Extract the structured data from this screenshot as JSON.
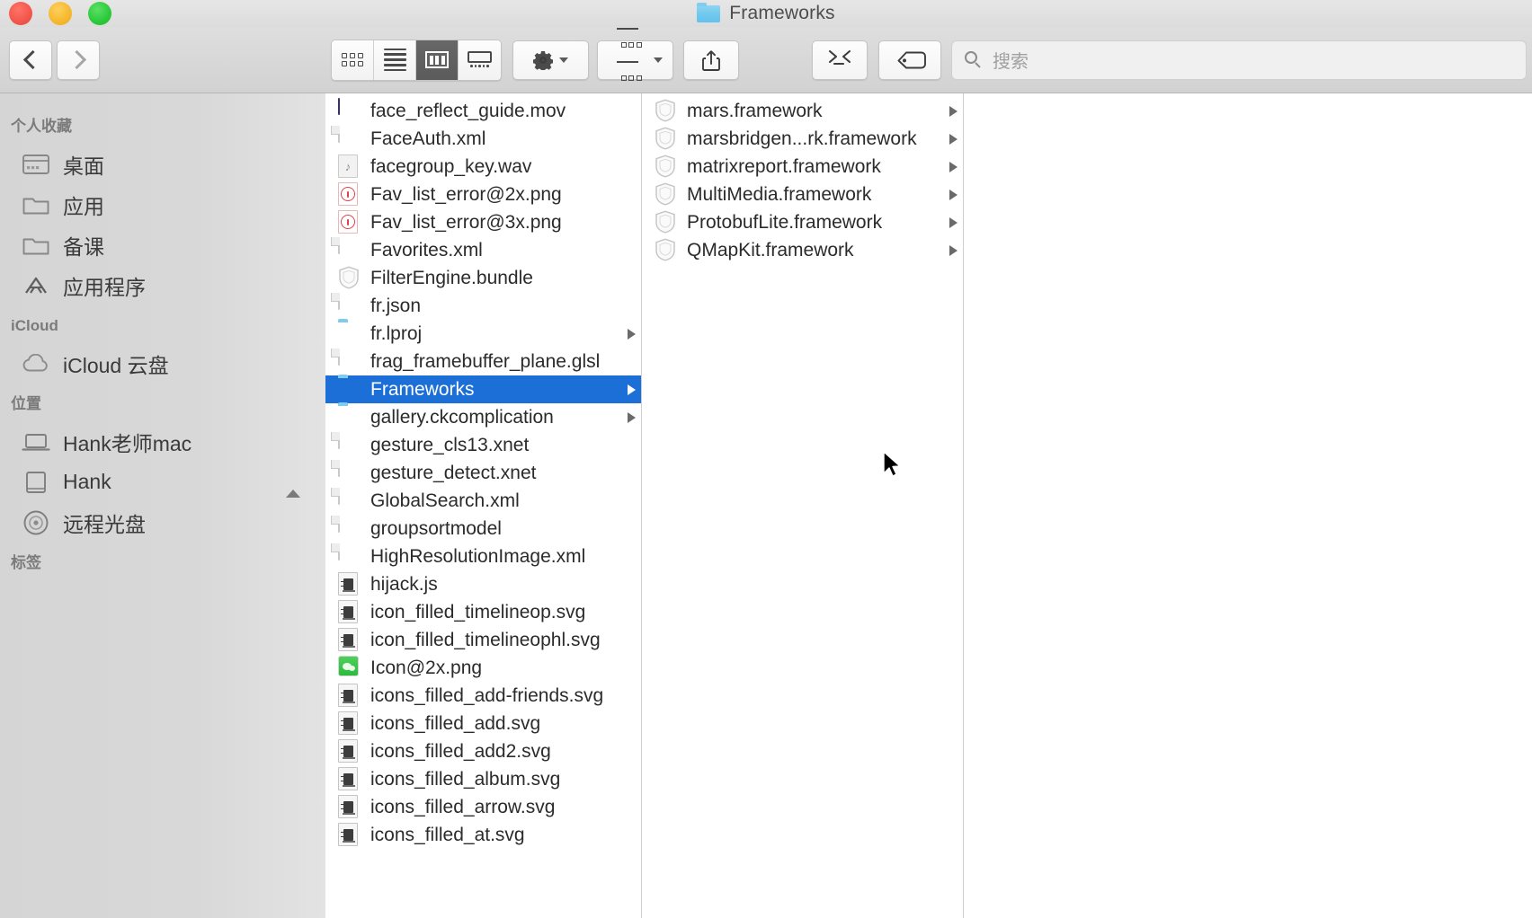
{
  "window": {
    "title": "Frameworks",
    "title_icon": "folder-icon",
    "traffic_lights": [
      {
        "name": "close-button",
        "color": "#f2564c"
      },
      {
        "name": "minimize-button",
        "color": "#f5b82e"
      },
      {
        "name": "maximize-button",
        "color": "#2bc93a"
      }
    ]
  },
  "toolbar": {
    "back_label": "chevron-left-icon",
    "forward_label": "chevron-right-icon",
    "view_modes": [
      {
        "name": "icon-view",
        "icon": "grid-icon",
        "active": false
      },
      {
        "name": "list-view",
        "icon": "list-icon",
        "active": false
      },
      {
        "name": "column-view",
        "icon": "columns-icon",
        "active": true
      },
      {
        "name": "gallery-view",
        "icon": "coverflow-icon",
        "active": false
      }
    ],
    "action_menu": {
      "icon": "gear-icon",
      "caret": "chevron-down-icon"
    },
    "arrange_menu": {
      "icon": "arrange-icon",
      "caret": "chevron-down-icon"
    },
    "share_button": {
      "icon": "share-icon"
    },
    "terminal_button": {
      "icon": "terminal-icon"
    },
    "tag_button": {
      "icon": "tag-icon"
    },
    "search": {
      "icon": "search-icon",
      "placeholder": "搜索",
      "value": ""
    }
  },
  "sidebar": {
    "sections": [
      {
        "header": "个人收藏",
        "items": [
          {
            "label": "桌面",
            "icon": "desktop-icon",
            "eject": false
          },
          {
            "label": "应用",
            "icon": "folder-outline-icon",
            "eject": false
          },
          {
            "label": "备课",
            "icon": "folder-outline-icon",
            "eject": false
          },
          {
            "label": "应用程序",
            "icon": "applications-icon",
            "eject": false
          }
        ]
      },
      {
        "header": "iCloud",
        "items": [
          {
            "label": "iCloud 云盘",
            "icon": "cloud-icon",
            "eject": false
          }
        ]
      },
      {
        "header": "位置",
        "items": [
          {
            "label": "Hank老师mac",
            "icon": "laptop-icon",
            "eject": false
          },
          {
            "label": "Hank",
            "icon": "harddisk-icon",
            "eject": true
          },
          {
            "label": "远程光盘",
            "icon": "optical-disc-icon",
            "eject": false
          }
        ]
      },
      {
        "header": "标签",
        "items": []
      }
    ]
  },
  "columns": [
    {
      "name": "file-column-1",
      "rows": [
        {
          "label": "face_reflect_guide.mov",
          "icon": "movie-file-icon",
          "kind": "mov",
          "arrow": false,
          "selected": false
        },
        {
          "label": "FaceAuth.xml",
          "icon": "document-icon",
          "kind": "doc",
          "arrow": false,
          "selected": false
        },
        {
          "label": "facegroup_key.wav",
          "icon": "audio-file-icon",
          "kind": "wav",
          "arrow": false,
          "selected": false
        },
        {
          "label": "Fav_list_error@2x.png",
          "icon": "error-image-icon",
          "kind": "err",
          "arrow": false,
          "selected": false
        },
        {
          "label": "Fav_list_error@3x.png",
          "icon": "error-image-icon",
          "kind": "err",
          "arrow": false,
          "selected": false
        },
        {
          "label": "Favorites.xml",
          "icon": "document-icon",
          "kind": "doc",
          "arrow": false,
          "selected": false
        },
        {
          "label": "FilterEngine.bundle",
          "icon": "bundle-icon",
          "kind": "bundle",
          "arrow": false,
          "selected": false
        },
        {
          "label": "fr.json",
          "icon": "document-icon",
          "kind": "doc",
          "arrow": false,
          "selected": false
        },
        {
          "label": "fr.lproj",
          "icon": "folder-icon",
          "kind": "folder",
          "arrow": true,
          "selected": false
        },
        {
          "label": "frag_framebuffer_plane.glsl",
          "icon": "document-icon",
          "kind": "doc",
          "arrow": false,
          "selected": false
        },
        {
          "label": "Frameworks",
          "icon": "folder-icon",
          "kind": "folder",
          "arrow": true,
          "selected": true
        },
        {
          "label": "gallery.ckcomplication",
          "icon": "folder-icon",
          "kind": "folder",
          "arrow": true,
          "selected": false
        },
        {
          "label": "gesture_cls13.xnet",
          "icon": "document-icon",
          "kind": "doc",
          "arrow": false,
          "selected": false
        },
        {
          "label": "gesture_detect.xnet",
          "icon": "document-icon",
          "kind": "doc",
          "arrow": false,
          "selected": false
        },
        {
          "label": "GlobalSearch.xml",
          "icon": "document-icon",
          "kind": "doc",
          "arrow": false,
          "selected": false
        },
        {
          "label": "groupsortmodel",
          "icon": "document-icon",
          "kind": "doc",
          "arrow": false,
          "selected": false
        },
        {
          "label": "HighResolutionImage.xml",
          "icon": "document-icon",
          "kind": "doc",
          "arrow": false,
          "selected": false
        },
        {
          "label": "hijack.js",
          "icon": "code-file-icon",
          "kind": "code",
          "arrow": false,
          "selected": false
        },
        {
          "label": "icon_filled_timelineop.svg",
          "icon": "code-file-icon",
          "kind": "code",
          "arrow": false,
          "selected": false
        },
        {
          "label": "icon_filled_timelineophl.svg",
          "icon": "code-file-icon",
          "kind": "code",
          "arrow": false,
          "selected": false
        },
        {
          "label": "Icon@2x.png",
          "icon": "green-app-image-icon",
          "kind": "green",
          "arrow": false,
          "selected": false
        },
        {
          "label": "icons_filled_add-friends.svg",
          "icon": "code-file-icon",
          "kind": "code",
          "arrow": false,
          "selected": false
        },
        {
          "label": "icons_filled_add.svg",
          "icon": "code-file-icon",
          "kind": "code",
          "arrow": false,
          "selected": false
        },
        {
          "label": "icons_filled_add2.svg",
          "icon": "code-file-icon",
          "kind": "code",
          "arrow": false,
          "selected": false
        },
        {
          "label": "icons_filled_album.svg",
          "icon": "code-file-icon",
          "kind": "code",
          "arrow": false,
          "selected": false
        },
        {
          "label": "icons_filled_arrow.svg",
          "icon": "code-file-icon",
          "kind": "code",
          "arrow": false,
          "selected": false
        },
        {
          "label": "icons_filled_at.svg",
          "icon": "code-file-icon",
          "kind": "code",
          "arrow": false,
          "selected": false
        }
      ]
    },
    {
      "name": "file-column-2",
      "rows": [
        {
          "label": "mars.framework",
          "icon": "framework-bundle-icon",
          "kind": "bundle",
          "arrow": true,
          "selected": false
        },
        {
          "label": "marsbridgen...rk.framework",
          "icon": "framework-bundle-icon",
          "kind": "bundle",
          "arrow": true,
          "selected": false
        },
        {
          "label": "matrixreport.framework",
          "icon": "framework-bundle-icon",
          "kind": "bundle",
          "arrow": true,
          "selected": false
        },
        {
          "label": "MultiMedia.framework",
          "icon": "framework-bundle-icon",
          "kind": "bundle",
          "arrow": true,
          "selected": false
        },
        {
          "label": "ProtobufLite.framework",
          "icon": "framework-bundle-icon",
          "kind": "bundle",
          "arrow": true,
          "selected": false
        },
        {
          "label": "QMapKit.framework",
          "icon": "framework-bundle-icon",
          "kind": "bundle",
          "arrow": true,
          "selected": false
        }
      ]
    },
    {
      "name": "file-column-3",
      "rows": []
    }
  ],
  "colors": {
    "selection_blue": "#1d6fd8",
    "folder_blue": "#6ec5ee",
    "titlebar_gray": "#dcdcdc",
    "sidebar_gray": "#d8d8d8"
  }
}
